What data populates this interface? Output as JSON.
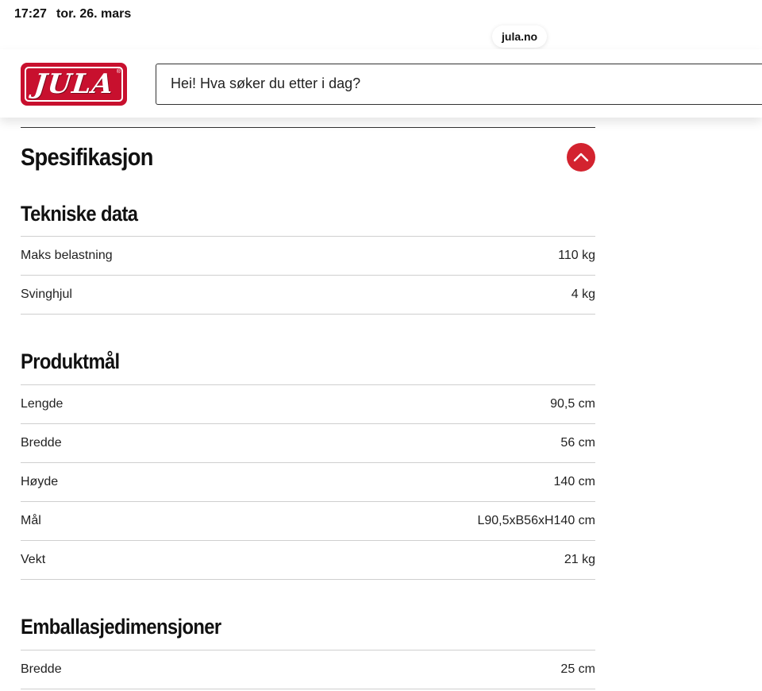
{
  "status_bar": {
    "time": "17:27",
    "date": "tor. 26. mars"
  },
  "browser": {
    "url": "jula.no"
  },
  "header": {
    "logo_text": "JULA",
    "logo_reg": "®",
    "search_placeholder": "Hei! Hva søker du etter i dag?"
  },
  "spec": {
    "title": "Spesifikasjon",
    "collapse_icon": "chevron-up-icon",
    "accent_color": "#d3232f",
    "sections": [
      {
        "title": "Tekniske data",
        "rows": [
          {
            "label": "Maks belastning",
            "value": "110 kg"
          },
          {
            "label": "Svinghjul",
            "value": "4 kg"
          }
        ]
      },
      {
        "title": "Produktmål",
        "rows": [
          {
            "label": "Lengde",
            "value": "90,5 cm"
          },
          {
            "label": "Bredde",
            "value": "56 cm"
          },
          {
            "label": "Høyde",
            "value": "140 cm"
          },
          {
            "label": "Mål",
            "value": "L90,5xB56xH140 cm"
          },
          {
            "label": "Vekt",
            "value": "21 kg"
          }
        ]
      },
      {
        "title": "Emballasjedimensjoner",
        "rows": [
          {
            "label": "Bredde",
            "value": "25 cm"
          }
        ]
      }
    ]
  }
}
